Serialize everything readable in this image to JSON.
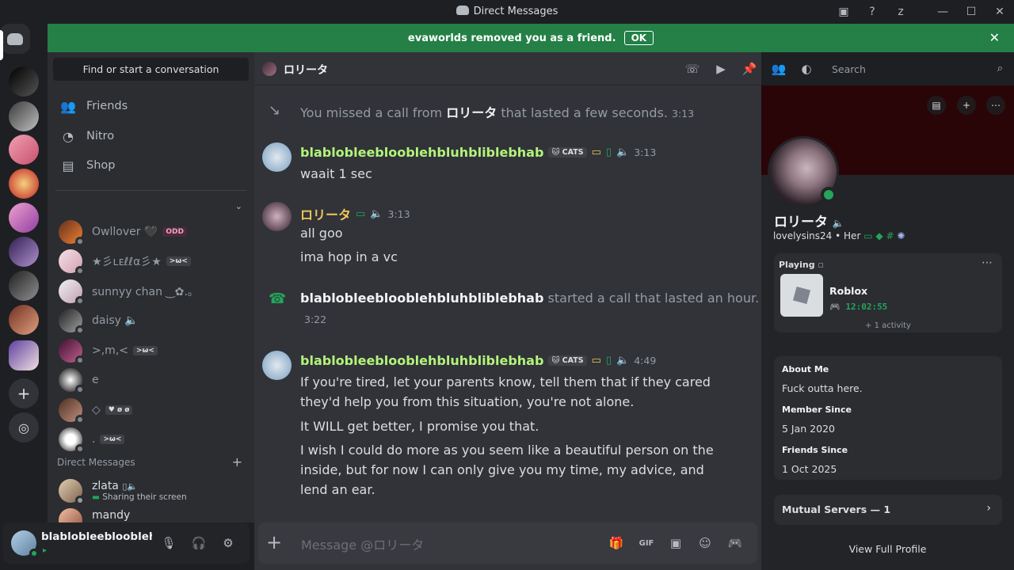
{
  "window": {
    "title": "Direct Messages"
  },
  "banner": {
    "text": "evaworlds removed you as a friend.",
    "ok": "OK"
  },
  "sidebar": {
    "find": "Find or start a conversation",
    "nav": [
      {
        "label": "Friends",
        "icon": "friends-icon"
      },
      {
        "label": "Nitro",
        "icon": "nitro-icon"
      },
      {
        "label": "Shop",
        "icon": "shop-icon"
      }
    ],
    "favorites_header": "",
    "dms": [
      {
        "name": "Owllover",
        "extra": "🖤",
        "tag": "ODD"
      },
      {
        "name": "★彡ʟᴇℓℓα彡★",
        "extra": "",
        "tag": ">ω<"
      },
      {
        "name": "sunnyy chan ‿✿.｡",
        "extra": "",
        "tag": ""
      },
      {
        "name": "daisy",
        "extra": "🔈",
        "tag": ""
      },
      {
        "name": ">,m,<",
        "extra": "",
        "tag": ">ω<"
      },
      {
        "name": "e",
        "extra": "",
        "tag": ""
      },
      {
        "name": "◇",
        "extra": "",
        "tag": "♥ ø ø"
      },
      {
        "name": ".",
        "extra": "",
        "tag": ">ω<"
      }
    ],
    "direct_messages_label": "Direct Messages",
    "recent": [
      {
        "name": "zlata",
        "sub": "Sharing their screen"
      },
      {
        "name": "mandy",
        "sub": ""
      }
    ]
  },
  "user": {
    "name": "blablobleeblooblehbluhbliblebhab",
    "status": "▸"
  },
  "chat": {
    "recipient": "ロリータ",
    "search_placeholder": "Search",
    "composer_placeholder": "Message @ロリータ",
    "messages": [
      {
        "kind": "system",
        "pre": "You missed a call from",
        "bold": "ロリータ",
        "post": "that lasted a few seconds.",
        "time": "3:13"
      },
      {
        "kind": "msg",
        "author": "blablobleeblooblehbluhbliblebhab",
        "badge": "CATS",
        "time": "3:13",
        "lines": [
          "waait 1 sec"
        ]
      },
      {
        "kind": "msg",
        "author": "ロリータ",
        "badge": "",
        "time": "3:13",
        "lines": [
          "all goo",
          "ima hop in a vc"
        ]
      },
      {
        "kind": "system",
        "bold": "blablobleeblooblehbluhbliblebhab",
        "post": "started a call that lasted an hour.",
        "time": "3:22"
      },
      {
        "kind": "msg",
        "author": "blablobleeblooblehbluhbliblebhab",
        "badge": "CATS",
        "time": "4:49",
        "lines": [
          "If you're tired, let your parents know, tell them that if they cared they'd help you from this situation, you're not alone.",
          "It WILL get better, I promise you that.",
          "I wish I could do more as you seem like a beautiful person on the inside, but for now I can only give you my time, my advice, and lend an ear."
        ]
      }
    ]
  },
  "profile": {
    "name": "ロリータ",
    "username": "lovelysins24",
    "pronouns": "Her",
    "activity": {
      "label": "Playing",
      "game": "Roblox",
      "elapsed": "12:02:55",
      "more": "+ 1 activity"
    },
    "about_label": "About Me",
    "about": "Fuck outta here.",
    "member_since_label": "Member Since",
    "member_since": "5 Jan 2020",
    "friends_since_label": "Friends Since",
    "friends_since": "1 Oct 2025",
    "mutual": "Mutual Servers — 1",
    "view_full": "View Full Profile"
  },
  "colors": {
    "green_name": "#b3f47a",
    "gold_name": "#f0c75b",
    "banner": "#248046",
    "status_online": "#23a55a"
  }
}
